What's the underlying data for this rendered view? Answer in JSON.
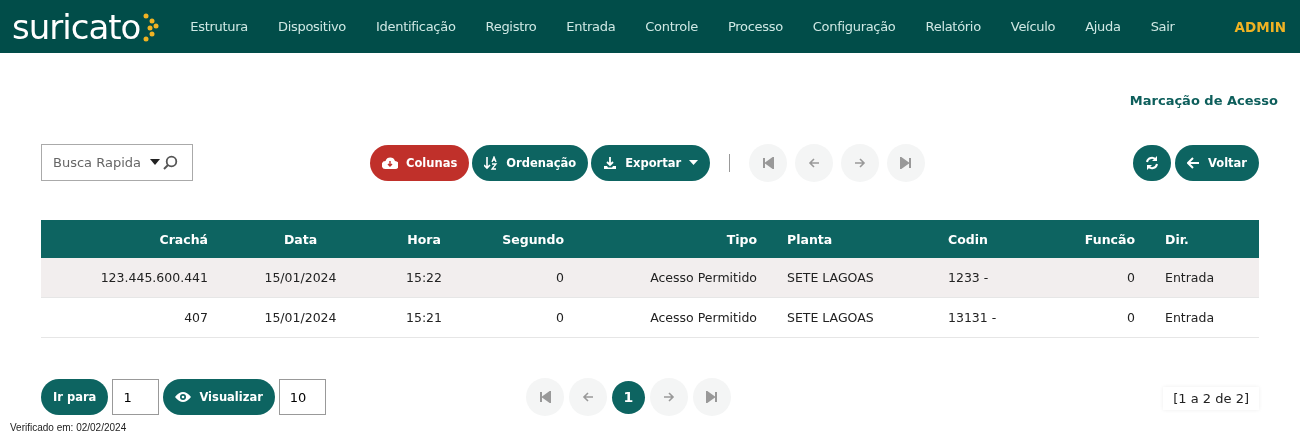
{
  "header": {
    "logo": "suricato",
    "menu": [
      "Estrutura",
      "Dispositivo",
      "Identificação",
      "Registro",
      "Entrada",
      "Controle",
      "Processo",
      "Configuração",
      "Relatório",
      "Veículo",
      "Ajuda",
      "Sair"
    ],
    "user": "ADMIN"
  },
  "page_title": "Marcação de Acesso",
  "toolbar": {
    "search": {
      "placeholder": "Busca Rapida"
    },
    "buttons": [
      {
        "label": "Colunas",
        "kind": "columns"
      },
      {
        "label": "Ordenação",
        "kind": "sort"
      },
      {
        "label": "Exportar",
        "kind": "export"
      }
    ],
    "pager": [
      {
        "kind": "first",
        "disabled": true
      },
      {
        "kind": "prev",
        "disabled": true
      },
      {
        "kind": "next",
        "disabled": true
      },
      {
        "kind": "last",
        "disabled": true
      }
    ],
    "right_buttons": [
      {
        "kind": "refresh"
      },
      {
        "kind": "back",
        "label": "Voltar"
      }
    ]
  },
  "table": {
    "columns": [
      "Crachá",
      "Data",
      "Hora",
      "Segundo",
      "Tipo",
      "Planta",
      "Codin",
      "Funcão",
      "Dir."
    ],
    "rows": [
      [
        "123.445.600.441",
        "15/01/2024",
        "15:22",
        "0",
        "Acesso Permitido",
        "SETE LAGOAS",
        "1233 -",
        "0",
        "Entrada"
      ],
      [
        "407",
        "15/01/2024",
        "15:21",
        "0",
        "Acesso Permitido",
        "SETE LAGOAS",
        "13131 -",
        "0",
        "Entrada"
      ]
    ]
  },
  "footer": {
    "goto": {
      "label": "Ir para",
      "value": "1"
    },
    "view": {
      "label": "Visualizar",
      "value": "10"
    },
    "pager": [
      {
        "kind": "first",
        "disabled": true
      },
      {
        "kind": "prev",
        "disabled": true
      },
      {
        "kind": "page",
        "label": "1",
        "selected": true
      },
      {
        "kind": "next",
        "disabled": true
      },
      {
        "kind": "last",
        "disabled": true
      }
    ],
    "range": "[1 a 2 de 2]",
    "verified": "Verificado em: 02/02/2024"
  }
}
